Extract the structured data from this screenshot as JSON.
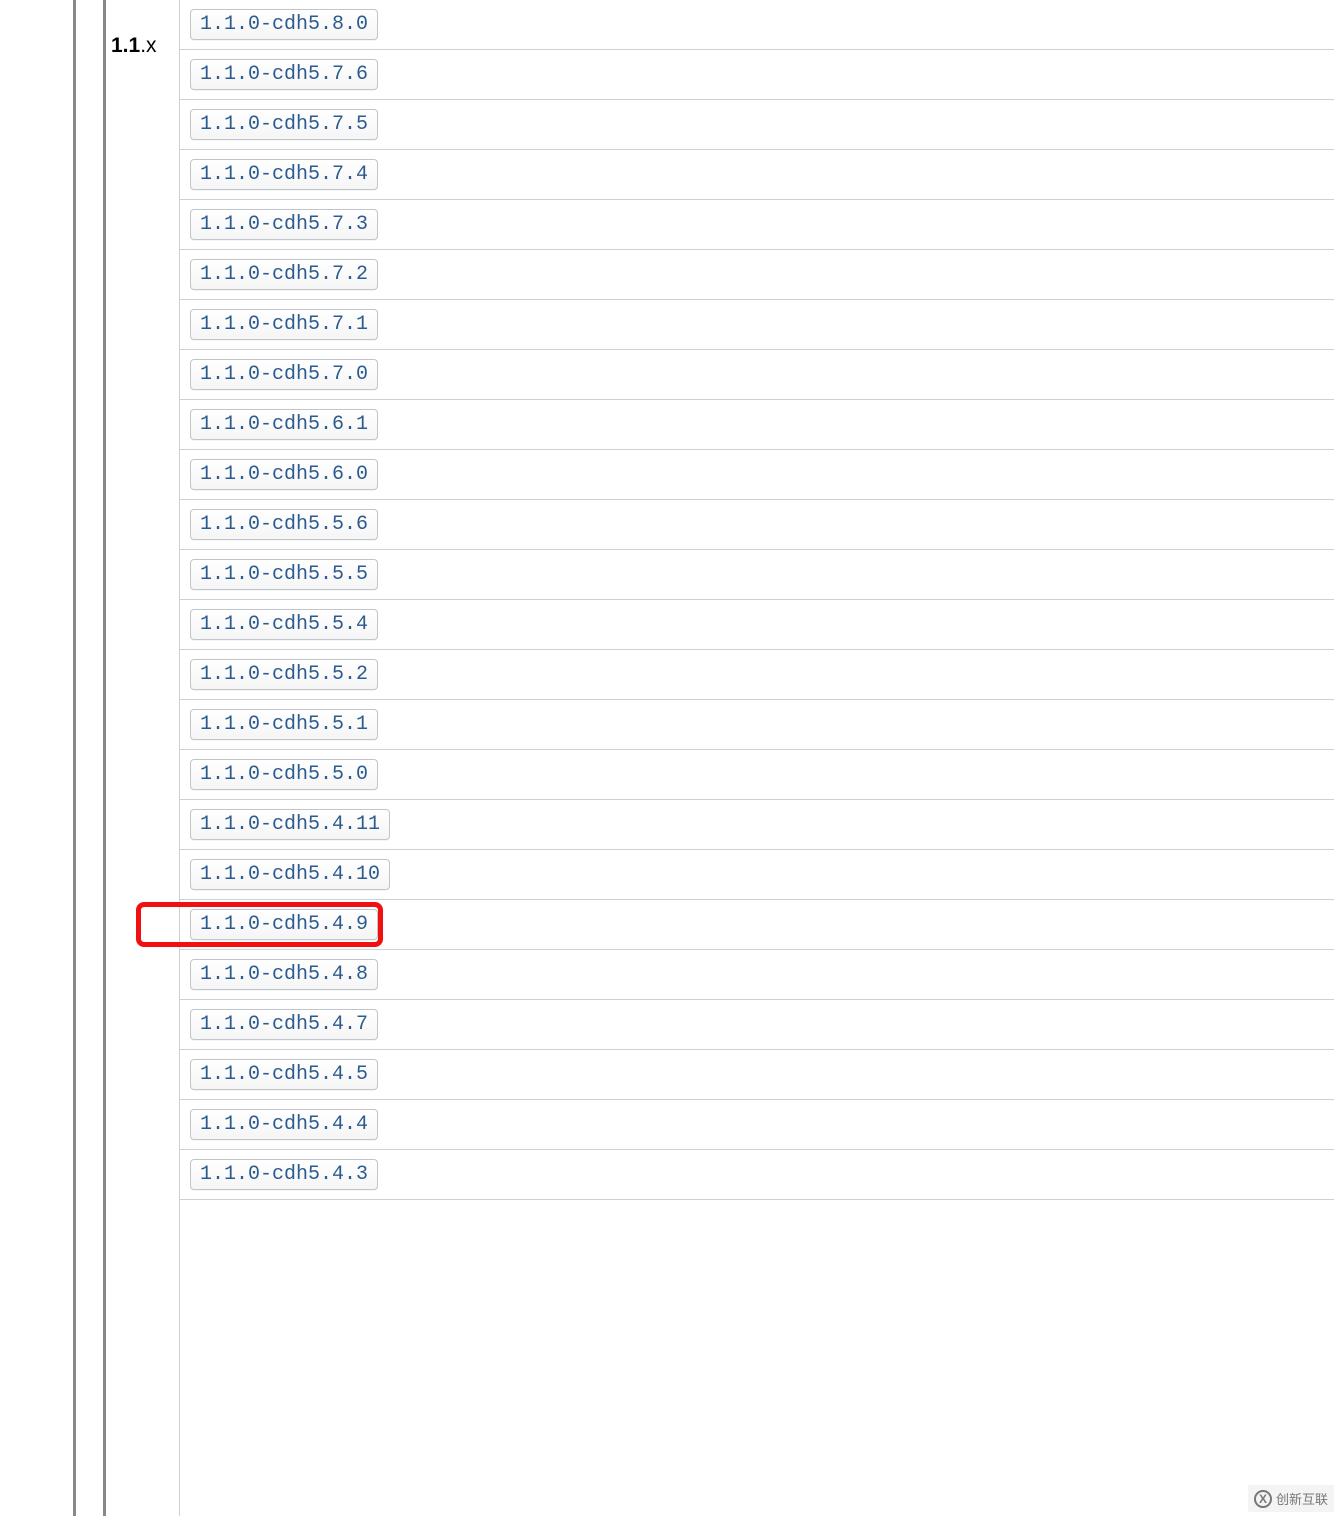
{
  "version_group": {
    "prefix": "1.1",
    "suffix": ".x"
  },
  "versions": [
    {
      "label": "1.1.0-cdh5.8.0",
      "highlighted": false
    },
    {
      "label": "1.1.0-cdh5.7.6",
      "highlighted": false
    },
    {
      "label": "1.1.0-cdh5.7.5",
      "highlighted": false
    },
    {
      "label": "1.1.0-cdh5.7.4",
      "highlighted": false
    },
    {
      "label": "1.1.0-cdh5.7.3",
      "highlighted": false
    },
    {
      "label": "1.1.0-cdh5.7.2",
      "highlighted": false
    },
    {
      "label": "1.1.0-cdh5.7.1",
      "highlighted": false
    },
    {
      "label": "1.1.0-cdh5.7.0",
      "highlighted": false
    },
    {
      "label": "1.1.0-cdh5.6.1",
      "highlighted": false
    },
    {
      "label": "1.1.0-cdh5.6.0",
      "highlighted": false
    },
    {
      "label": "1.1.0-cdh5.5.6",
      "highlighted": false
    },
    {
      "label": "1.1.0-cdh5.5.5",
      "highlighted": false
    },
    {
      "label": "1.1.0-cdh5.5.4",
      "highlighted": false
    },
    {
      "label": "1.1.0-cdh5.5.2",
      "highlighted": false
    },
    {
      "label": "1.1.0-cdh5.5.1",
      "highlighted": false
    },
    {
      "label": "1.1.0-cdh5.5.0",
      "highlighted": false
    },
    {
      "label": "1.1.0-cdh5.4.11",
      "highlighted": false
    },
    {
      "label": "1.1.0-cdh5.4.10",
      "highlighted": false
    },
    {
      "label": "1.1.0-cdh5.4.9",
      "highlighted": true
    },
    {
      "label": "1.1.0-cdh5.4.8",
      "highlighted": false
    },
    {
      "label": "1.1.0-cdh5.4.7",
      "highlighted": false
    },
    {
      "label": "1.1.0-cdh5.4.5",
      "highlighted": false
    },
    {
      "label": "1.1.0-cdh5.4.4",
      "highlighted": false
    },
    {
      "label": "1.1.0-cdh5.4.3",
      "highlighted": false
    }
  ],
  "watermark": {
    "text": "创新互联"
  }
}
